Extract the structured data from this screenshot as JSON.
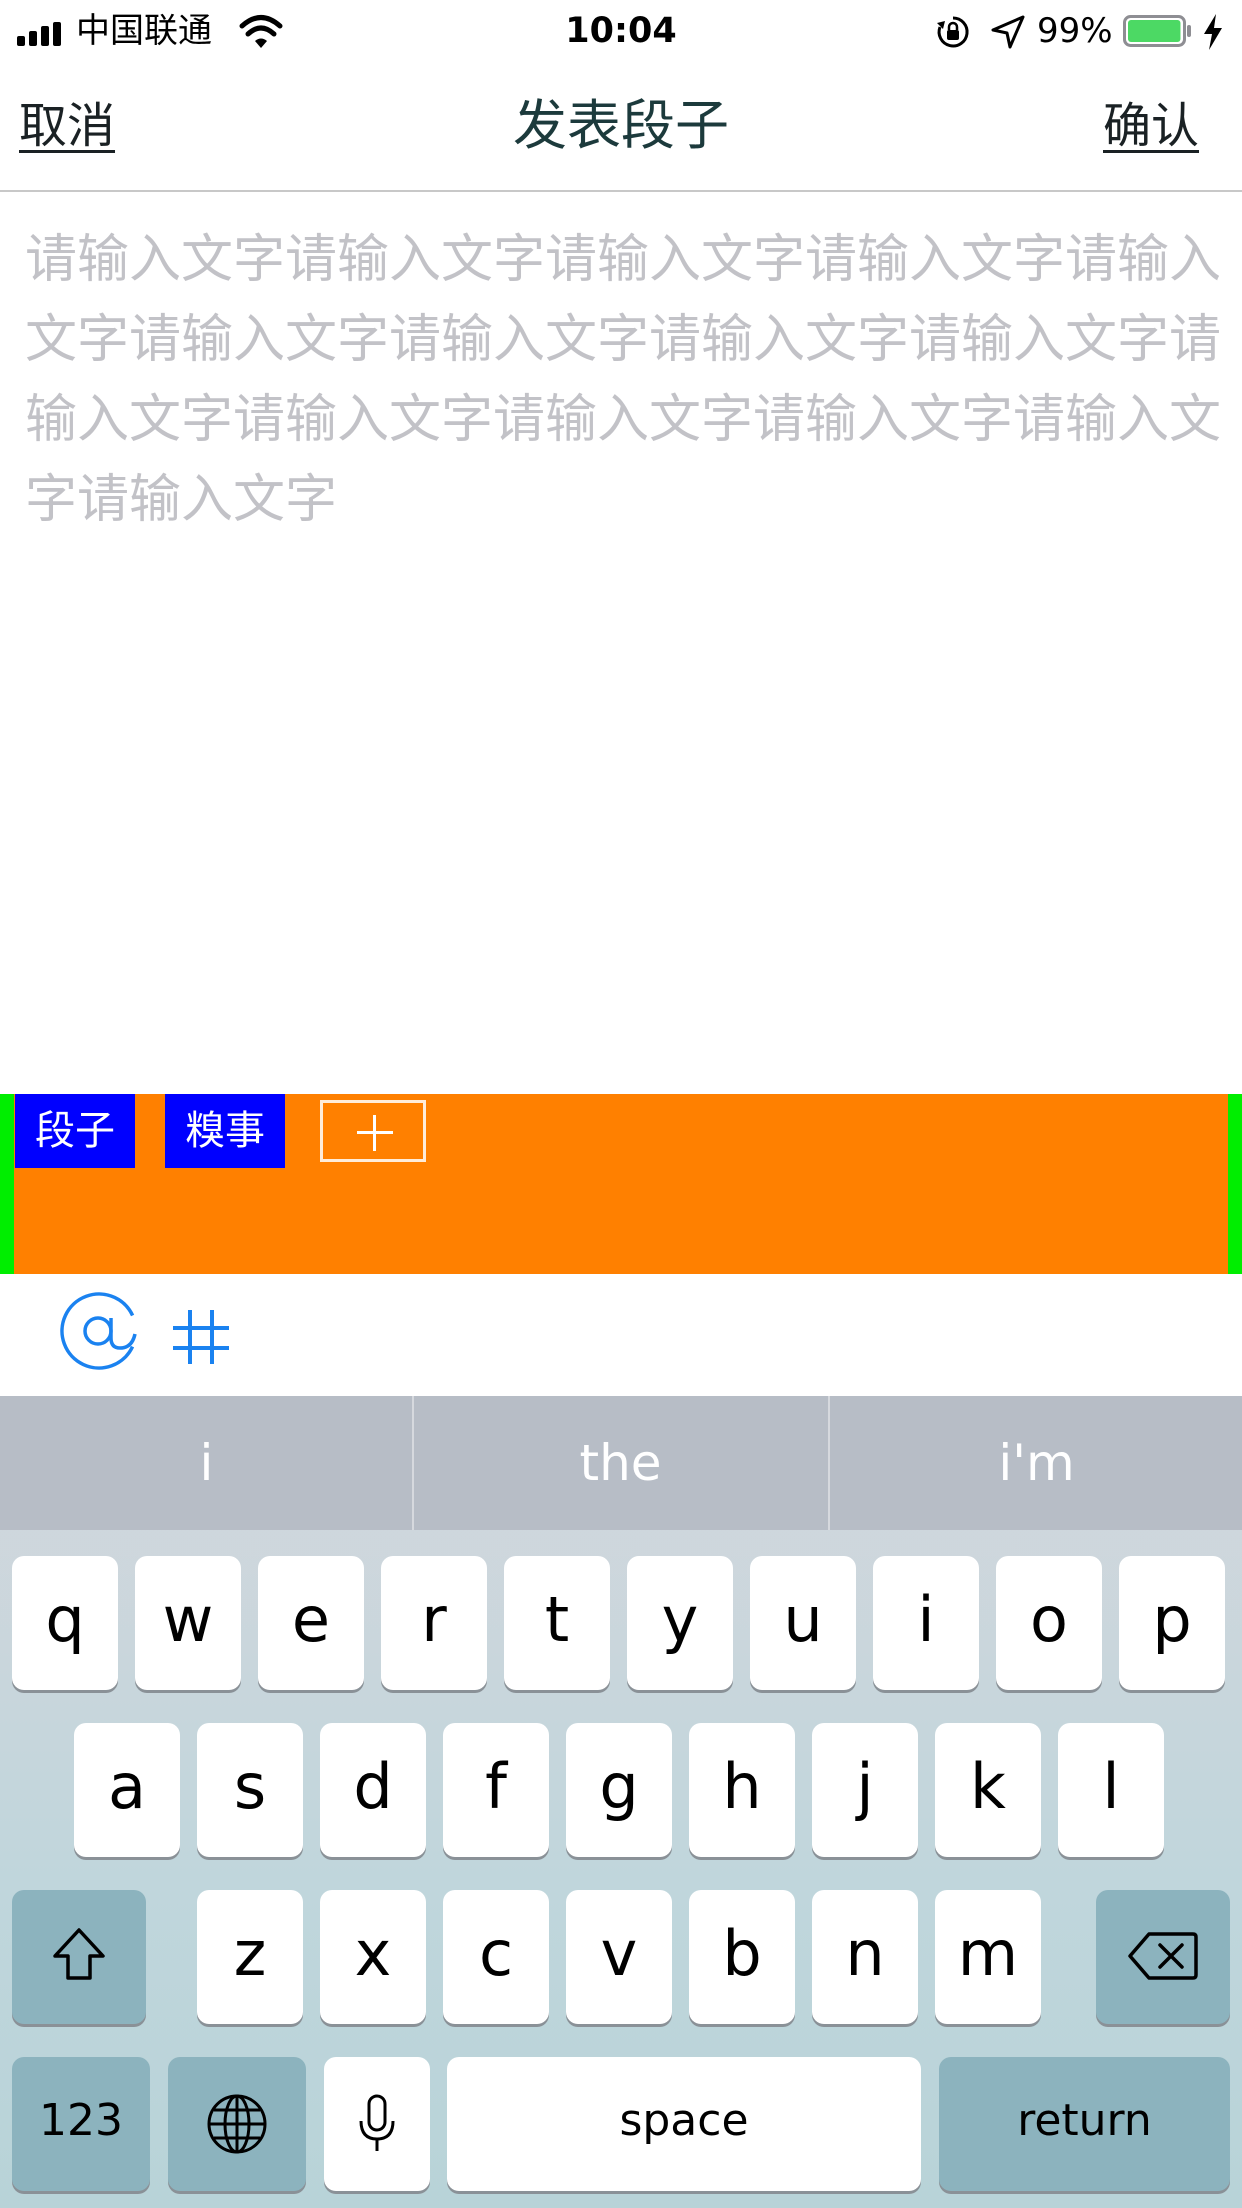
{
  "status_bar": {
    "carrier": "中国联通",
    "time": "10:04",
    "battery_percent": "99%",
    "battery_level": 0.99,
    "battery_color": "#4cd964",
    "icons": [
      "signal-icon",
      "wifi-icon",
      "rotation-lock-icon",
      "location-arrow-icon",
      "battery-icon",
      "charging-bolt-icon"
    ]
  },
  "nav": {
    "cancel": "取消",
    "title": "发表段子",
    "confirm": "确认"
  },
  "compose": {
    "placeholder": "请输入文字请输入文字请输入文字请输入文字请输入文字请输入文字请输入文字请输入文字请输入文字请输入文字请输入文字请输入文字请输入文字请输入文字请输入文字"
  },
  "tags": {
    "items": [
      "段子",
      "糗事"
    ],
    "bar_color": "#ff8000",
    "tag_color": "#0000ff",
    "edge_color": "#00ee00"
  },
  "tools": {
    "accent": "#1a82f0",
    "icons": [
      "at-icon",
      "hashtag-icon"
    ]
  },
  "keyboard": {
    "suggestions": [
      "i",
      "the",
      "i'm"
    ],
    "row1": [
      "q",
      "w",
      "e",
      "r",
      "t",
      "y",
      "u",
      "i",
      "o",
      "p"
    ],
    "row2": [
      "a",
      "s",
      "d",
      "f",
      "g",
      "h",
      "j",
      "k",
      "l"
    ],
    "row3": [
      "z",
      "x",
      "c",
      "v",
      "b",
      "n",
      "m"
    ],
    "numbers_label": "123",
    "space_label": "space",
    "return_label": "return",
    "icons": [
      "shift-icon",
      "delete-icon",
      "globe-icon",
      "microphone-icon"
    ]
  }
}
